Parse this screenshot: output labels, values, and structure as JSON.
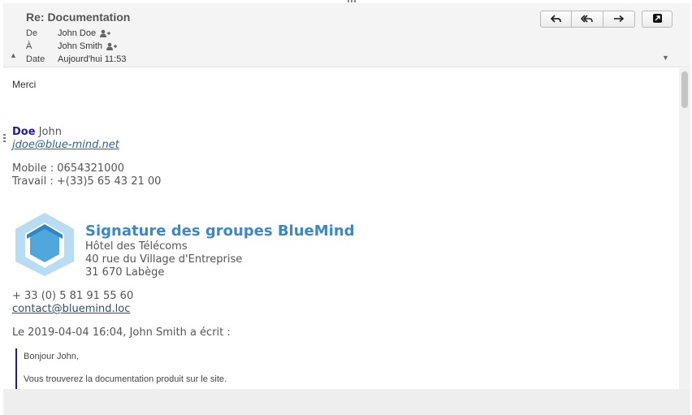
{
  "header": {
    "subject": "Re: Documentation",
    "from_label": "De",
    "from_value": "John Doe",
    "to_label": "À",
    "to_value": "John Smith",
    "date_label": "Date",
    "date_value": "Aujourd'hui 11:53"
  },
  "toolbar": {
    "icons": [
      "reply-icon",
      "reply-all-icon",
      "forward-icon",
      "open-external-icon"
    ]
  },
  "message": {
    "greeting": "Merci",
    "signature": {
      "last_name": "Doe",
      "first_name": "John",
      "email": "jdoe@blue-mind.net",
      "mobile": "Mobile : 0654321000",
      "work": "Travail : +(33)5 65 43 21 00"
    },
    "group": {
      "title": "Signature des groupes BlueMind",
      "line1": "Hôtel des Télécoms",
      "line2": "40 rue du Village d'Entreprise",
      "line3": "31 670 Labège",
      "phone": "+ 33 (0) 5 81 91 55 60",
      "email": "contact@bluemind.loc"
    },
    "quote_intro": "Le 2019-04-04 16:04, John Smith a écrit :",
    "quote_line1": "Bonjour John,",
    "quote_line2": "Vous trouverez la documentation produit sur le site."
  },
  "colors": {
    "accent_blue": "#3b87c8",
    "quote_bar": "#1a1aa6",
    "logo_light": "#b8dcf2",
    "logo_dark": "#4fa7dc"
  }
}
